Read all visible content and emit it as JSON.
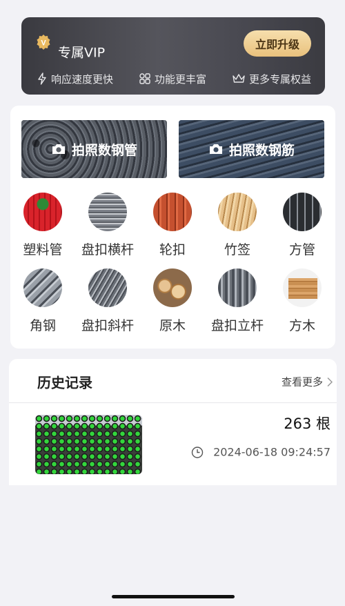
{
  "vip": {
    "title": "专属VIP",
    "upgrade_label": "立即升级",
    "badge_letter": "V",
    "features": [
      {
        "icon": "lightning-icon",
        "label": "响应速度更快"
      },
      {
        "icon": "grid-icon",
        "label": "功能更丰富"
      },
      {
        "icon": "crown-icon",
        "label": "更多专属权益"
      }
    ]
  },
  "scan": [
    {
      "label": "拍照数钢管",
      "icon": "camera-icon"
    },
    {
      "label": "拍照数钢筋",
      "icon": "camera-icon"
    }
  ],
  "categories": [
    {
      "label": "塑料管"
    },
    {
      "label": "盘扣横杆"
    },
    {
      "label": "轮扣"
    },
    {
      "label": "竹签"
    },
    {
      "label": "方管"
    },
    {
      "label": "角钢"
    },
    {
      "label": "盘扣斜杆"
    },
    {
      "label": "原木"
    },
    {
      "label": "盘扣立杆"
    },
    {
      "label": "方木"
    }
  ],
  "history": {
    "title": "历史记录",
    "more_label": "查看更多",
    "items": [
      {
        "count": "263 根",
        "time": "2024-06-18 09:24:57"
      }
    ]
  },
  "colors": {
    "vip_gold": "#e9c17d",
    "page_bg": "#f2f2f6"
  }
}
